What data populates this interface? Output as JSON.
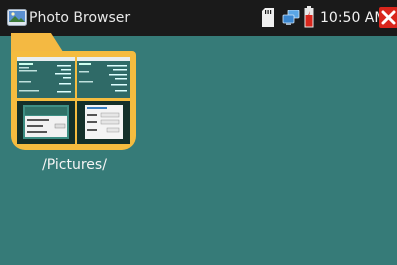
{
  "statusbar": {
    "app_title": "Photo Browser",
    "app_icon": "photo-browser-icon",
    "time": "10:50 AM",
    "icons": [
      "sd-card-icon",
      "network-icon",
      "battery-icon"
    ],
    "close_icon": "close-icon"
  },
  "gallery": {
    "folders": [
      {
        "label": "/Pictures/",
        "icon": "folder-icon"
      }
    ]
  },
  "colors": {
    "background": "#367b78",
    "statusbar": "#1a1a1a",
    "folder": "#f5bc3f",
    "close": "#d9261c"
  }
}
